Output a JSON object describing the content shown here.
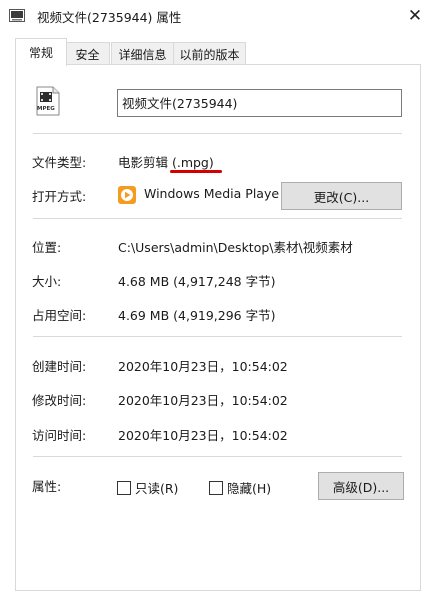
{
  "window": {
    "title": "视频文件(2735944) 属性",
    "close_glyph": "✕"
  },
  "tabs": [
    {
      "label": "常规",
      "active": true
    },
    {
      "label": "安全",
      "active": false
    },
    {
      "label": "详细信息",
      "active": false
    },
    {
      "label": "以前的版本",
      "active": false
    }
  ],
  "general": {
    "file_name": "视频文件(2735944)",
    "file_icon_caption": "MPEG",
    "type_label": "文件类型:",
    "type_value": "电影剪辑 (.mpg)",
    "opens_with_label": "打开方式:",
    "opens_with_value": "Windows Media Playe",
    "change_button": "更改(C)...",
    "location_label": "位置:",
    "location_value": "C:\\Users\\admin\\Desktop\\素材\\视频素材",
    "size_label": "大小:",
    "size_value": "4.68 MB (4,917,248 字节)",
    "size_on_disk_label": "占用空间:",
    "size_on_disk_value": "4.69 MB (4,919,296 字节)",
    "created_label": "创建时间:",
    "created_value": "2020年10月23日，10:54:02",
    "modified_label": "修改时间:",
    "modified_value": "2020年10月23日，10:54:02",
    "accessed_label": "访问时间:",
    "accessed_value": "2020年10月23日，10:54:02",
    "attributes_label": "属性:",
    "readonly_label": "只读(R)",
    "hidden_label": "隐藏(H)",
    "advanced_button": "高级(D)..."
  },
  "colors": {
    "underline_annotation": "#d40000",
    "wmp_icon": "#f39c1f"
  }
}
